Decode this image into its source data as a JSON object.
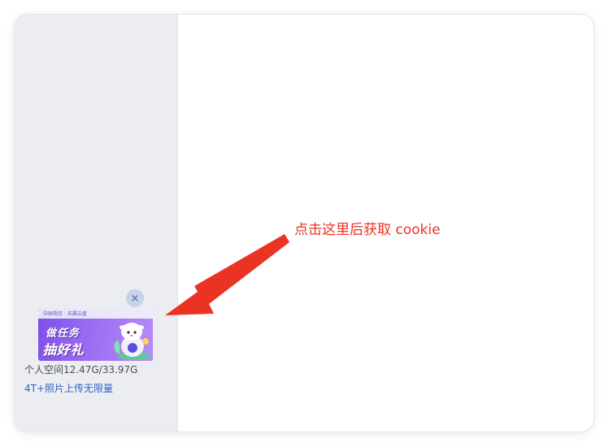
{
  "sidebar": {
    "promo": {
      "brand_text": "中国电信 · 天翼云盘",
      "line1": "做任务",
      "line2": "抽好礼",
      "close_symbol": "×"
    },
    "storage_text": "个人空间12.47G/33.97G",
    "upgrade_link": "4T+照片上传无限量"
  },
  "annotation": {
    "text": "点击这里后获取 cookie",
    "color": "#ea3323"
  },
  "colors": {
    "sidebar_bg": "#ebedf1",
    "link": "#2e63c8",
    "promo_purple": "#7d4fe6"
  },
  "icons": {
    "close": "close-icon",
    "mascot": "mascot-illustration"
  }
}
